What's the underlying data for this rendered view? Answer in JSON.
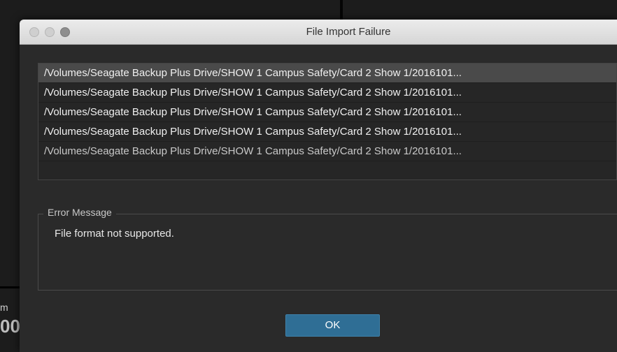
{
  "background": {
    "text_fragment_1": "m",
    "text_fragment_2": "00"
  },
  "dialog": {
    "title": "File Import Failure",
    "files": [
      "/Volumes/Seagate Backup Plus Drive/SHOW 1 Campus Safety/Card 2 Show 1/2016101...",
      "/Volumes/Seagate Backup Plus Drive/SHOW 1 Campus Safety/Card 2 Show 1/2016101...",
      "/Volumes/Seagate Backup Plus Drive/SHOW 1 Campus Safety/Card 2 Show 1/2016101...",
      "/Volumes/Seagate Backup Plus Drive/SHOW 1 Campus Safety/Card 2 Show 1/2016101...",
      "/Volumes/Seagate Backup Plus Drive/SHOW 1 Campus Safety/Card 2 Show 1/2016101..."
    ],
    "error_label": "Error Message",
    "error_text": "File format not supported.",
    "ok_label": "OK"
  },
  "colors": {
    "accent_button": "#2f6e95",
    "dialog_bg": "#2a2a2a",
    "selected_row": "#4a4a4a"
  }
}
